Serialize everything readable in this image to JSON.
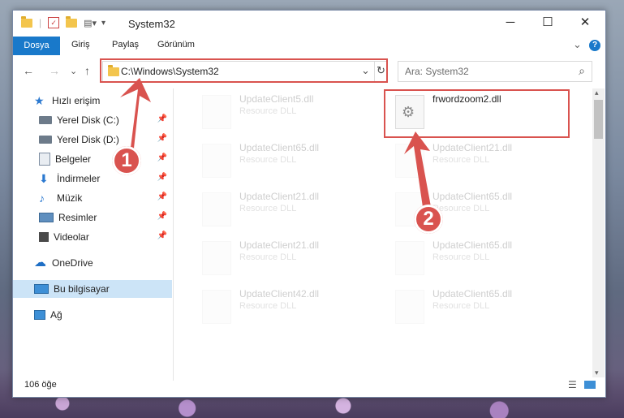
{
  "window": {
    "title": "System32",
    "controls": {
      "minimize": "─",
      "maximize": "☐",
      "close": "✕"
    }
  },
  "ribbon": {
    "tabs": [
      "Dosya",
      "Giriş",
      "Paylaş",
      "Görünüm"
    ],
    "expand_icon": "⌄",
    "help_icon": "?"
  },
  "address_bar": {
    "path": "C:\\Windows\\System32",
    "dropdown_icon": "⌄",
    "refresh_icon": "↻"
  },
  "search": {
    "placeholder": "Ara: System32",
    "icon": "⌕"
  },
  "nav": {
    "back": "←",
    "forward": "→",
    "recent": "⌄",
    "up": "↑"
  },
  "sidebar": {
    "items": [
      {
        "label": "Hızlı erişim",
        "icon": "star-icon",
        "pinned": false
      },
      {
        "label": "Yerel Disk (C:)",
        "icon": "drive-icon",
        "pinned": true
      },
      {
        "label": "Yerel Disk (D:)",
        "icon": "drive-icon",
        "pinned": true
      },
      {
        "label": "Belgeler",
        "icon": "documents-icon",
        "pinned": true
      },
      {
        "label": "İndirmeler",
        "icon": "download-icon",
        "pinned": true
      },
      {
        "label": "Müzik",
        "icon": "music-icon",
        "pinned": true
      },
      {
        "label": "Resimler",
        "icon": "pictures-icon",
        "pinned": true
      },
      {
        "label": "Videolar",
        "icon": "video-icon",
        "pinned": true
      },
      {
        "label": "OneDrive",
        "icon": "cloud-icon",
        "pinned": false
      },
      {
        "label": "Bu bilgisayar",
        "icon": "computer-icon",
        "pinned": false,
        "selected": true
      },
      {
        "label": "Ağ",
        "icon": "network-icon",
        "pinned": false
      }
    ]
  },
  "files": [
    {
      "name": "UpdateClient5.dll",
      "type": "Resource DLL",
      "faded": true
    },
    {
      "name": "frwordzoom2.dll",
      "type": "",
      "faded": false,
      "highlighted": true
    },
    {
      "name": "UpdateClient65.dll",
      "type": "Resource DLL",
      "faded": true
    },
    {
      "name": "UpdateClient21.dll",
      "type": "Resource DLL",
      "faded": true
    },
    {
      "name": "UpdateClient21.dll",
      "type": "Resource DLL",
      "faded": true
    },
    {
      "name": "UpdateClient65.dll",
      "type": "Resource DLL",
      "faded": true
    },
    {
      "name": "UpdateClient21.dll",
      "type": "Resource DLL",
      "faded": true
    },
    {
      "name": "UpdateClient65.dll",
      "type": "Resource DLL",
      "faded": true
    },
    {
      "name": "UpdateClient42.dll",
      "type": "Resource DLL",
      "faded": true
    },
    {
      "name": "UpdateClient65.dll",
      "type": "Resource DLL",
      "faded": true
    }
  ],
  "status": {
    "count": "106 öğe"
  },
  "callouts": [
    "1",
    "2"
  ],
  "colors": {
    "accent": "#1979ca",
    "highlight": "#d9534f",
    "selected_bg": "#cce4f7"
  }
}
